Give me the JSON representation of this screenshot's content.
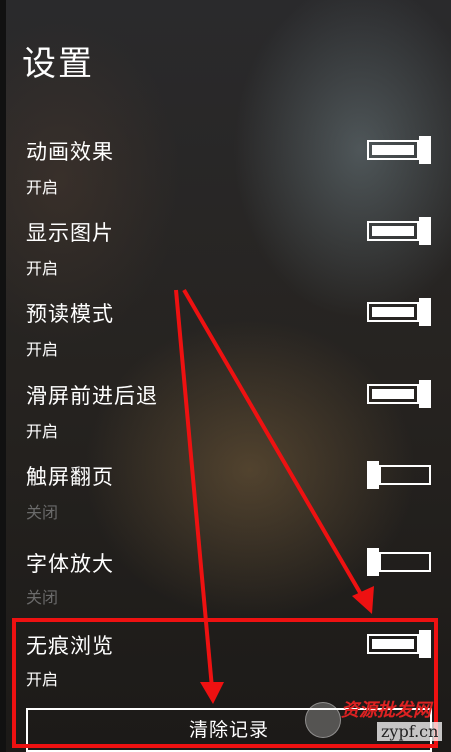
{
  "page": {
    "title": "设置"
  },
  "settings": [
    {
      "label": "动画效果",
      "state": "开启",
      "on": true
    },
    {
      "label": "显示图片",
      "state": "开启",
      "on": true
    },
    {
      "label": "预读模式",
      "state": "开启",
      "on": true
    },
    {
      "label": "滑屏前进后退",
      "state": "开启",
      "on": true
    },
    {
      "label": "触屏翻页",
      "state": "关闭",
      "on": false
    },
    {
      "label": "字体放大",
      "state": "关闭",
      "on": false
    },
    {
      "label": "无痕浏览",
      "state": "开启",
      "on": true
    }
  ],
  "clear_button": {
    "label": "清除记录"
  },
  "annotation": {
    "color": "#ee1111"
  },
  "watermark": {
    "main": "资源批发网",
    "sub": "zypf.cn"
  }
}
